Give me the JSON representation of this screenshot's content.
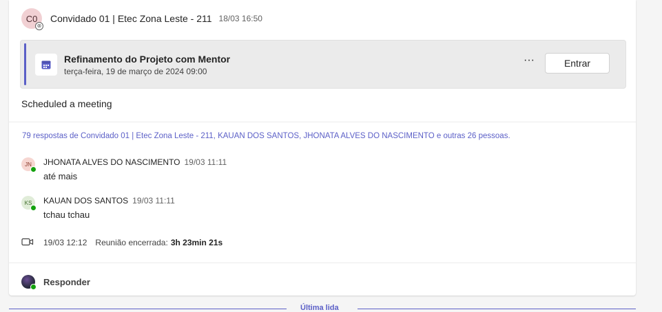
{
  "post": {
    "avatar_initials": "C0",
    "author": "Convidado 01 | Etec Zona Leste - 211",
    "timestamp": "18/03 16:50",
    "body": "Scheduled a meeting"
  },
  "meeting": {
    "title": "Refinamento do Projeto com Mentor",
    "datetime": "terça-feira, 19 de março de 2024 09:00",
    "more_label": "···",
    "join_label": "Entrar"
  },
  "replies_summary": "79 respostas de Convidado 01 | Etec Zona Leste - 211, KAUAN DOS SANTOS, JHONATA ALVES DO NASCIMENTO e outras 26 pessoas.",
  "replies": [
    {
      "initials": "JN",
      "author": "JHONATA ALVES DO NASCIMENTO",
      "time": "19/03 11:11",
      "text": "até mais",
      "avatar_bg": "#f6d6d1",
      "avatar_fg": "#8a3a2a"
    },
    {
      "initials": "KS",
      "author": "KAUAN DOS SANTOS",
      "time": "19/03 11:11",
      "text": "tchau tchau",
      "avatar_bg": "#e0ecd8",
      "avatar_fg": "#3f6b2a"
    }
  ],
  "meeting_ended": {
    "time": "19/03 12:12",
    "label": "Reunião encerrada:",
    "duration": "3h 23min 21s"
  },
  "reply_bar": {
    "label": "Responder"
  },
  "last_read": {
    "label": "Última lida"
  },
  "colors": {
    "accent": "#5b5fc7",
    "presence_available": "#13a10e"
  }
}
